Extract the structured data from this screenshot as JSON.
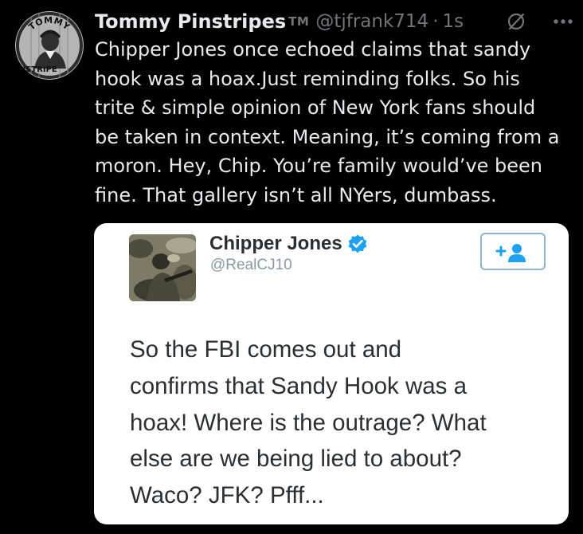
{
  "tweet": {
    "display_name": "Tommy Pinstripes",
    "name_badge": "TM",
    "handle": "@tjfrank714",
    "separator": "·",
    "timestamp": "1s",
    "avatar_text": {
      "top": "TOMMY",
      "side": "INSTRIPE"
    },
    "body_lines": [
      "Chipper Jones once echoed claims that sandy",
      "hook was a hoax.Just reminding folks. So his",
      "trite & simple opinion of New York fans should",
      "be taken in context. Meaning, it’s coming from a",
      "moron. Hey, Chip. You’re family would’ve been",
      "fine. That gallery isn’t all NYers, dumbass."
    ],
    "icons": {
      "grok": "grok-icon",
      "more": "more-icon"
    }
  },
  "embedded_screenshot": {
    "name": "Chipper Jones",
    "handle": "@RealCJ10",
    "verified": true,
    "follow_icon": "follow-icon",
    "accent_color": "#1da1f2",
    "text_lines": [
      "So the FBI comes out and",
      "confirms that Sandy Hook was a",
      "hoax! Where is the outrage? What",
      "else are we being lied to about?",
      "Waco? JFK? Pfff..."
    ]
  },
  "colors": {
    "background": "#000000",
    "primary_text": "#e7e9ea",
    "secondary_text": "#71767b",
    "embed_background": "#ffffff",
    "embed_text": "#292f33"
  }
}
